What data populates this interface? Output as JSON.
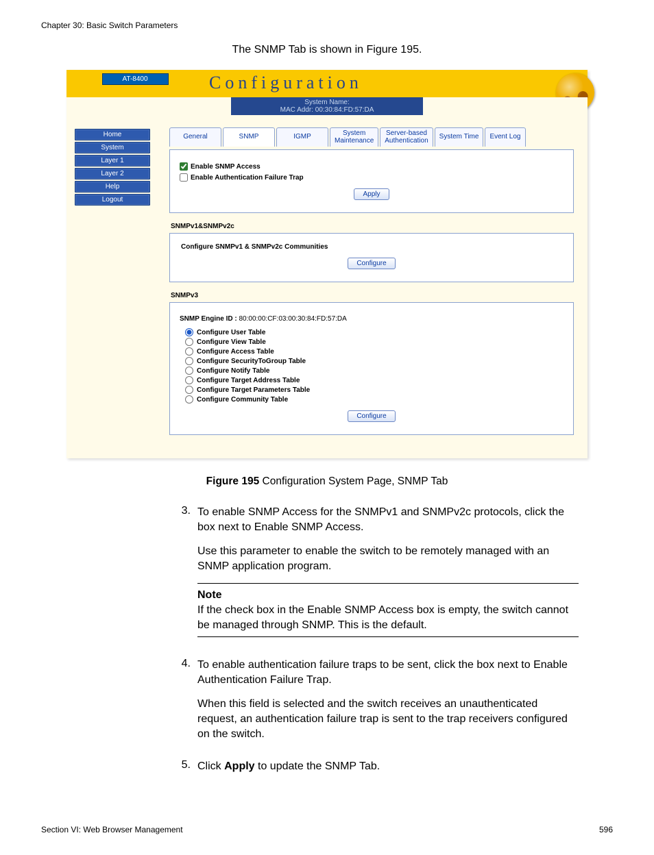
{
  "chapter": "Chapter 30: Basic Switch Parameters",
  "intro": "The SNMP Tab is shown in Figure 195.",
  "screenshot": {
    "device": "AT-8400",
    "title": "Configuration",
    "system_name_label": "System Name:",
    "mac_addr": "MAC Addr: 00:30:84:FD:57:DA",
    "nav": [
      "Home",
      "System",
      "Layer 1",
      "Layer 2",
      "Help",
      "Logout"
    ],
    "tabs": {
      "general": "General",
      "snmp": "SNMP",
      "igmp": "IGMP",
      "sysmaint1": "System",
      "sysmaint2": "Maintenance",
      "sbauth1": "Server-based",
      "sbauth2": "Authentication",
      "systime": "System Time",
      "eventlog": "Event Log"
    },
    "panel1": {
      "enable_snmp": "Enable SNMP Access",
      "enable_auth_trap": "Enable Authentication Failure Trap",
      "apply": "Apply"
    },
    "sec_v12_label": "SNMPv1&SNMPv2c",
    "sec_v12_sub": "Configure SNMPv1 & SNMPv2c Communities",
    "configure": "Configure",
    "sec_v3_label": "SNMPv3",
    "engine_id_label": "SNMP Engine ID :",
    "engine_id_value": "80:00:00:CF:03:00:30:84:FD:57:DA",
    "v3_options": [
      "Configure User Table",
      "Configure View Table",
      "Configure Access Table",
      "Configure SecurityToGroup Table",
      "Configure Notify Table",
      "Configure Target Address Table",
      "Configure Target Parameters Table",
      "Configure Community Table"
    ]
  },
  "figure_caption_bold": "Figure 195",
  "figure_caption_rest": "  Configuration System Page, SNMP Tab",
  "steps": {
    "s3a": "To enable SNMP Access for the SNMPv1 and SNMPv2c protocols, click the box next to Enable SNMP Access.",
    "s3b": "Use this parameter to enable the switch to be remotely managed with an SNMP application program.",
    "note_label": "Note",
    "note_body": "If the check box in the Enable SNMP Access box is empty, the switch cannot be managed through SNMP. This is the default.",
    "s4a": "To enable authentication failure traps to be sent, click the box next to Enable Authentication Failure Trap.",
    "s4b": "When this field is selected and the switch receives an unauthenticated request, an authentication failure trap is sent to the trap receivers configured on the switch.",
    "s5_prefix": "Click ",
    "s5_bold": "Apply",
    "s5_suffix": " to update the SNMP Tab."
  },
  "footer_left": "Section VI: Web Browser Management",
  "footer_right": "596"
}
